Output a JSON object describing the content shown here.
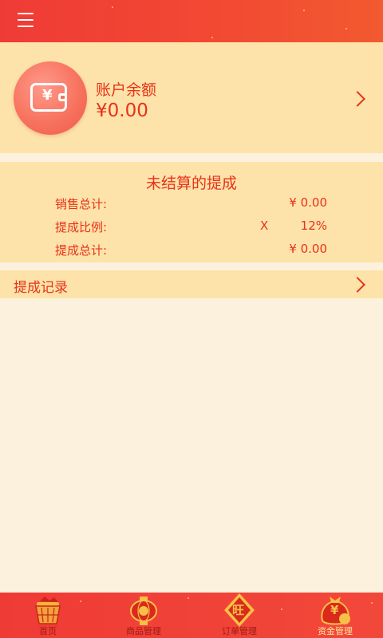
{
  "account": {
    "label": "账户余额",
    "balance": "¥0.00",
    "wallet_symbol": "¥"
  },
  "commission": {
    "title": "未结算的提成",
    "rows": [
      {
        "label": "销售总计:",
        "value": "¥ 0.00"
      },
      {
        "label": "提成比例:",
        "multiplier": "X",
        "value": "12%"
      },
      {
        "label": "提成总计:",
        "value": "¥ 0.00"
      }
    ]
  },
  "record": {
    "label": "提成记录"
  },
  "tabbar": {
    "items": [
      {
        "label": "首页",
        "icon": "home-basket-icon"
      },
      {
        "label": "商品管理",
        "icon": "lantern-icon"
      },
      {
        "label": "订单管理",
        "icon": "wang-diamond-icon",
        "badge_text": "旺"
      },
      {
        "label": "资金管理",
        "icon": "money-bag-icon",
        "badge_text": "¥",
        "active": true
      }
    ]
  },
  "colors": {
    "brand_red": "#ef3b36",
    "text_red": "#e8321b",
    "card_bg": "#fde3a9",
    "page_bg": "#fcf1dc",
    "active_tab": "#ffe7a0"
  }
}
